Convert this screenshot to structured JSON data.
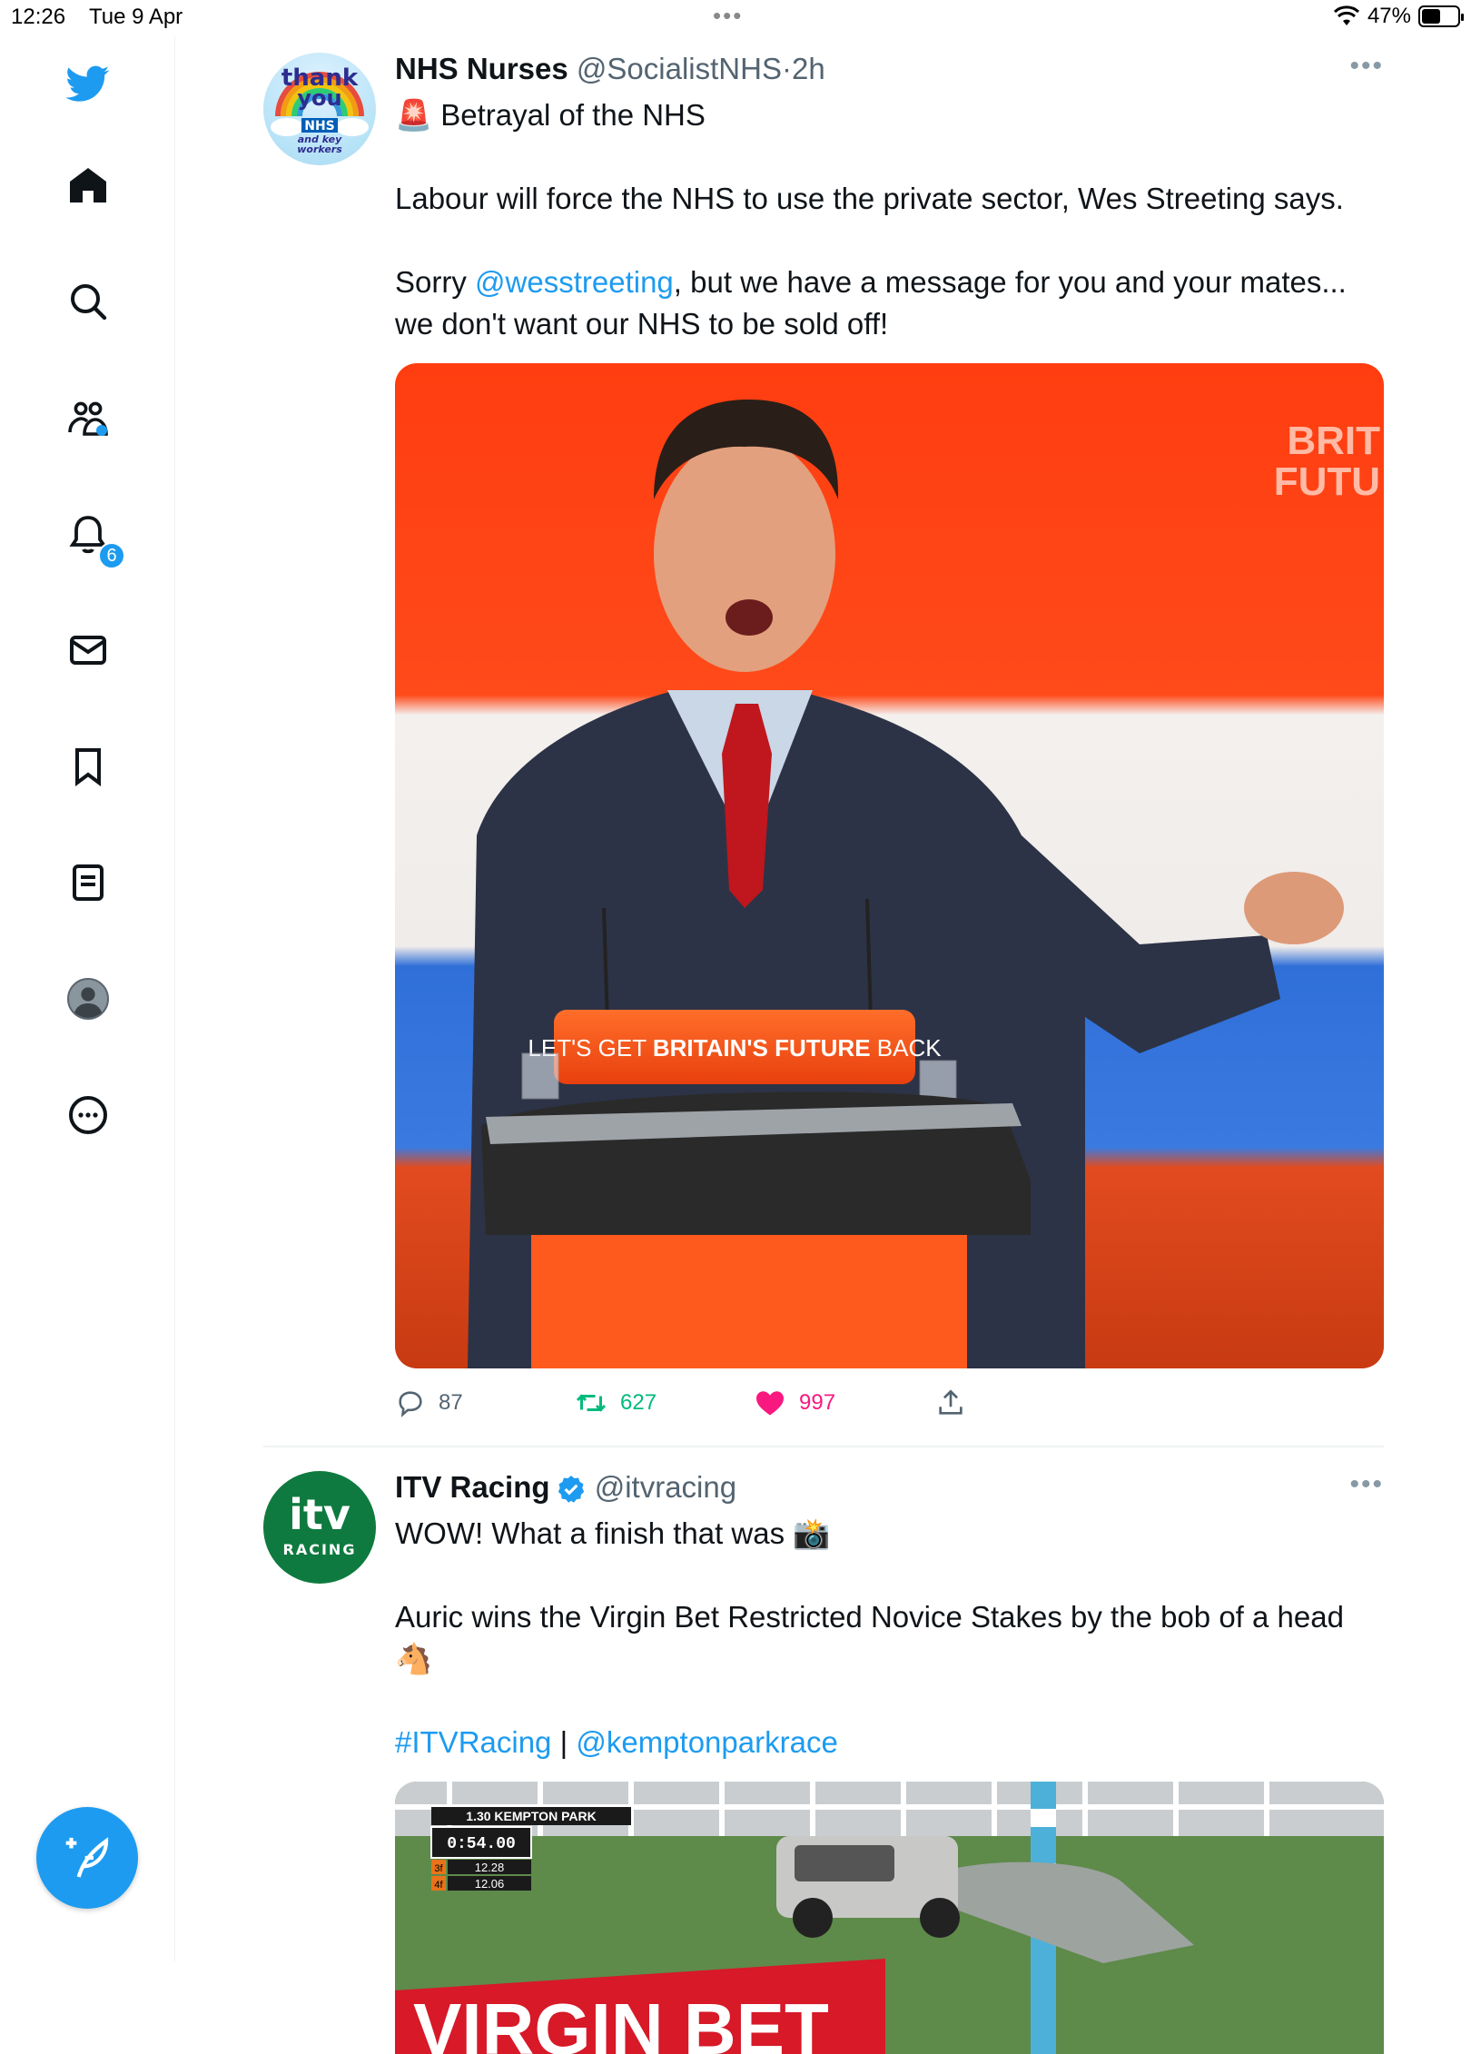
{
  "status_bar": {
    "time": "12:26",
    "date": "Tue 9 Apr",
    "battery": "47%"
  },
  "sidebar": {
    "notification_count": "6",
    "items": [
      "twitter-logo",
      "home",
      "explore",
      "communities",
      "notifications",
      "messages",
      "bookmarks",
      "lists",
      "profile",
      "more"
    ]
  },
  "tweets": [
    {
      "display_name": "NHS Nurses",
      "handle": "@SocialistNHS",
      "sep": "·",
      "time": "2h",
      "line1_emoji": "🚨",
      "line1_text": "Betrayal of the NHS",
      "para1": "Labour will force the NHS to use the private sector, Wes Streeting says.",
      "para2_prefix": "Sorry ",
      "para2_mention": "@wesstreeting",
      "para2_suffix": ", but we have a message for you and your mates...",
      "para3": "we don't want our NHS to be sold off!",
      "avatar": {
        "l1": "thank",
        "l2": "you",
        "l3": "NHS",
        "l4": "and key",
        "l5": "workers"
      },
      "image": {
        "backdrop_l1": "BRIT",
        "backdrop_l2": "FUTU",
        "podium_pre": "LET'S GET ",
        "podium_bold": "BRITAIN'S FUTURE",
        "podium_post": " BACK"
      },
      "replies": "87",
      "retweets": "627",
      "likes": "997"
    },
    {
      "display_name": "ITV Racing",
      "handle": "@itvracing",
      "line1_text": "WOW! What a finish that was",
      "line1_emoji": "📸",
      "para1": "Auric wins the Virgin Bet Restricted Novice Stakes by the bob of a head",
      "para1_emoji": "🐴",
      "hashtag": "#ITVRacing",
      "pipe": " | ",
      "mention": "@kemptonparkrace",
      "avatar": {
        "logo": "itv",
        "sub": "RACING"
      },
      "image": {
        "race_title": "1.30 KEMPTON PARK",
        "timer": "0:54.00",
        "split1_label": "3f",
        "split1_value": "12.28",
        "split2_label": "4f",
        "split2_value": "12.06",
        "banner": "VIRGIN BET"
      }
    }
  ],
  "colors": {
    "accent": "#1d9bf0",
    "retweet": "#00ba7c",
    "like": "#f91880"
  }
}
